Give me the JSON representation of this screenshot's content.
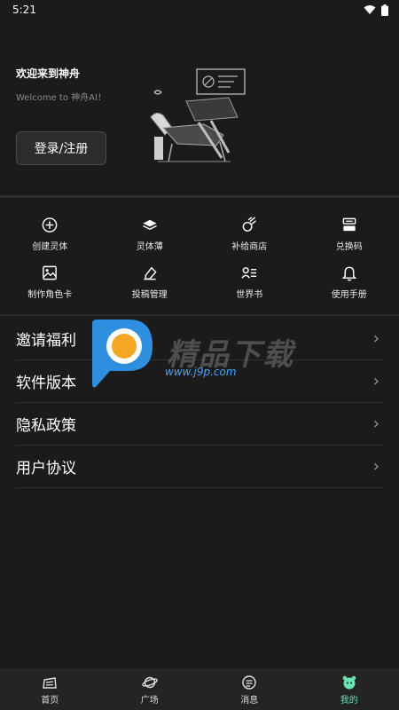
{
  "status": {
    "time": "5:21"
  },
  "header": {
    "welcome": "欢迎来到神舟",
    "welcome_sub": "Welcome to 神舟AI！",
    "login_label": "登录/注册"
  },
  "grid": [
    {
      "label": "创建灵体",
      "icon": "plus-circle-icon"
    },
    {
      "label": "灵体薄",
      "icon": "stack-icon"
    },
    {
      "label": "补给商店",
      "icon": "meteor-icon"
    },
    {
      "label": "兑换码",
      "icon": "code-box-icon"
    },
    {
      "label": "制作角色卡",
      "icon": "image-icon"
    },
    {
      "label": "投稿管理",
      "icon": "eraser-icon"
    },
    {
      "label": "世界书",
      "icon": "person-list-icon"
    },
    {
      "label": "使用手册",
      "icon": "bell-icon"
    }
  ],
  "menu": [
    {
      "label": "邀请福利"
    },
    {
      "label": "软件版本"
    },
    {
      "label": "隐私政策"
    },
    {
      "label": "用户协议"
    }
  ],
  "watermark": {
    "text": "精品下载",
    "url": "www.j9p.com"
  },
  "nav": [
    {
      "label": "首页",
      "icon": "home-icon"
    },
    {
      "label": "广场",
      "icon": "planet-icon"
    },
    {
      "label": "消息",
      "icon": "message-icon"
    },
    {
      "label": "我的",
      "icon": "profile-icon"
    }
  ],
  "colors": {
    "accent": "#6ae3b3",
    "background": "#1b1b1b"
  }
}
